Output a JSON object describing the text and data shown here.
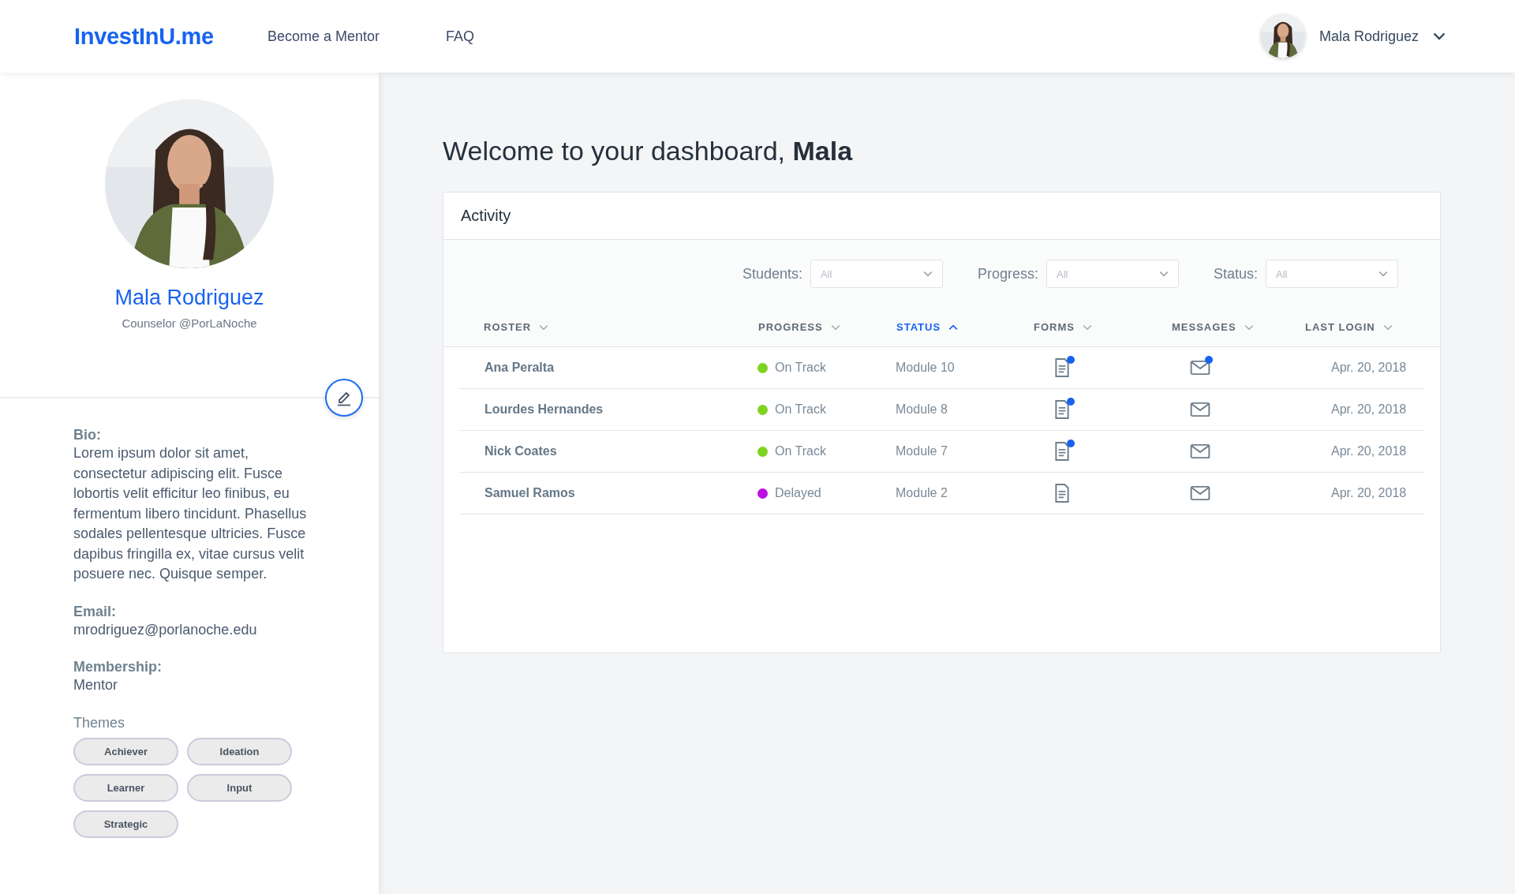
{
  "header": {
    "logo": "InvestInU.me",
    "nav": [
      {
        "label": "Become a Mentor"
      },
      {
        "label": "FAQ"
      }
    ],
    "user": {
      "name": "Mala Rodriguez"
    }
  },
  "profile": {
    "name": "Mala Rodriguez",
    "subtitle": "Counselor @PorLaNoche",
    "fields": [
      {
        "label": "Bio:",
        "value": "Lorem ipsum dolor sit amet, consectetur adipiscing elit. Fusce lobortis velit efficitur leo finibus, eu fermentum libero tincidunt. Phasellus sodales pellentesque ultricies. Fusce dapibus fringilla ex, vitae cursus velit posuere nec. Quisque semper."
      },
      {
        "label": "Email:",
        "value": "mrodriguez@porlanoche.edu"
      },
      {
        "label": "Membership:",
        "value": "Mentor"
      }
    ],
    "themes_label": "Themes",
    "themes": [
      "Achiever",
      "Ideation",
      "Learner",
      "Input",
      "Strategic"
    ]
  },
  "welcome": "Welcome to your dashboard, **Mala**",
  "activity": {
    "title": "Activity",
    "filters": [
      {
        "label": "Students:",
        "value": "All"
      },
      {
        "label": "Progress:",
        "value": "All"
      },
      {
        "label": "Status:",
        "value": "All"
      }
    ],
    "columns": [
      {
        "label": "ROSTER",
        "selected": false
      },
      {
        "label": "PROGRESS",
        "selected": false
      },
      {
        "label": "STATUS",
        "selected": true
      },
      {
        "label": "FORMS",
        "selected": false
      },
      {
        "label": "MESSAGES",
        "selected": false
      },
      {
        "label": "LAST LOGIN",
        "selected": false
      }
    ],
    "rows": [
      {
        "name": "Ana Peralta",
        "progress": "On Track",
        "color": "#7ed321",
        "status": "Module 10",
        "forms_unread": true,
        "messages_unread": true,
        "last_login": "Apr. 20, 2018"
      },
      {
        "name": "Lourdes Hernandes",
        "progress": "On Track",
        "color": "#7ed321",
        "status": "Module 8",
        "forms_unread": true,
        "messages_unread": false,
        "last_login": "Apr. 20, 2018"
      },
      {
        "name": "Nick Coates",
        "progress": "On Track",
        "color": "#7ed321",
        "status": "Module 7",
        "forms_unread": true,
        "messages_unread": false,
        "last_login": "Apr. 20, 2018"
      },
      {
        "name": "Samuel Ramos",
        "progress": "Delayed",
        "color": "#bd10e0",
        "status": "Module 2",
        "forms_unread": false,
        "messages_unread": false,
        "last_login": "Apr. 20, 2018"
      }
    ]
  }
}
